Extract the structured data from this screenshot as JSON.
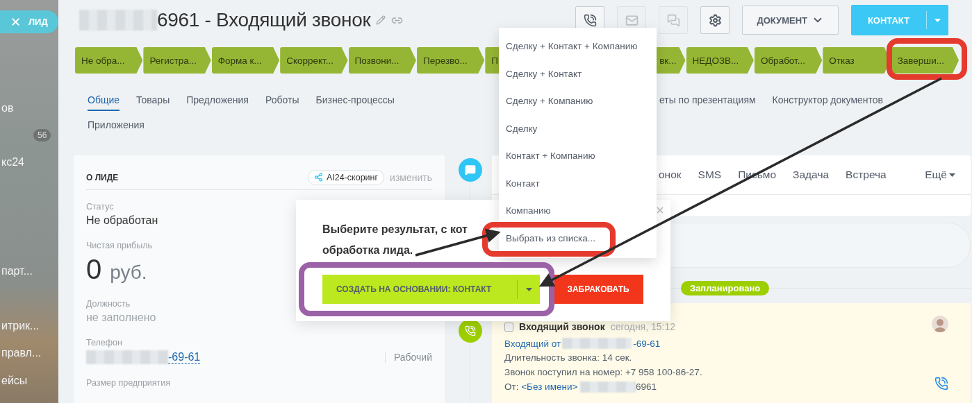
{
  "close_tab": {
    "label": "ЛИД"
  },
  "sidebar": {
    "items": [
      {
        "label": "ов"
      },
      {
        "badge": "56"
      },
      {
        "label": "кс24"
      },
      {
        "label": "парт..."
      },
      {
        "label": "итрик..."
      },
      {
        "label": "правл..."
      },
      {
        "label": "ейсы"
      }
    ]
  },
  "header": {
    "title": "6961 - Входящий звонок",
    "buttons": [
      {
        "kind": "phone",
        "disabled": false
      },
      {
        "kind": "mail",
        "disabled": true
      },
      {
        "kind": "chat",
        "disabled": true
      },
      {
        "kind": "settings",
        "disabled": false
      }
    ],
    "document_button": "ДОКУМЕНТ",
    "contact_button": "КОНТАКТ"
  },
  "stages": [
    {
      "label": "Не обра..."
    },
    {
      "label": "Регистра..."
    },
    {
      "label": "Форма к..."
    },
    {
      "label": "Скоррект..."
    },
    {
      "label": "Позвони..."
    },
    {
      "label": "Перезво..."
    },
    {
      "label": "П"
    },
    {
      "label": "вк...",
      "partly_hidden": true
    },
    {
      "label": "НЕДОЗВ..."
    },
    {
      "label": "Обработ..."
    },
    {
      "label": "Отказ"
    },
    {
      "label": "Заверши..."
    }
  ],
  "tabs": [
    {
      "label": "Общие",
      "selected": true
    },
    {
      "label": "Товары",
      "selected": false
    },
    {
      "label": "Предложения",
      "selected": false
    },
    {
      "label": "Роботы",
      "selected": false
    },
    {
      "label": "Бизнес-процессы",
      "selected": false
    },
    {
      "label": "еты по презентациям",
      "selected": false,
      "partly_hidden": true
    },
    {
      "label": "Конструктор документов",
      "selected": false
    },
    {
      "label": "Приложения",
      "selected": false
    }
  ],
  "about": {
    "title": "О ЛИДЕ",
    "scoring_badge": "AI24-скоринг",
    "edit_link": "изменить",
    "fields": [
      {
        "kind": "text",
        "label": "Статус",
        "value": "Не обработан"
      },
      {
        "kind": "money",
        "label": "Чистая прибыль",
        "value": "0",
        "unit": "руб."
      },
      {
        "kind": "empty",
        "label": "Должность",
        "value": "не заполнено"
      },
      {
        "kind": "phone",
        "label": "Телефон",
        "value": "-69-61",
        "type": "Рабочий"
      },
      {
        "kind": "label",
        "label": "Размер предприятия"
      }
    ]
  },
  "activity_tabs": [
    {
      "label": "онок",
      "partly_hidden": true
    },
    {
      "label": "SMS"
    },
    {
      "label": "Письмо"
    },
    {
      "label": "Задача"
    },
    {
      "label": "Встреча"
    },
    {
      "label": "Ещё",
      "kind": "more"
    }
  ],
  "scheduled_label": "Запланировано",
  "activity": {
    "checked": false,
    "title": "Входящий звонок",
    "time": "сегодня, 15:12",
    "link": "Входящий от",
    "link_suffix": "-69-61",
    "lines": [
      "Длительность звонка: 14 сек.",
      "Звонок поступил на номер: +7 958 100-86-27."
    ],
    "from_label": "От:",
    "from_name": "<Без имени>",
    "from_number": "6961"
  },
  "popup": {
    "message_lines": [
      "Выберите результат, с кот",
      "обработка лида."
    ],
    "create_button": "СОЗДАТЬ НА ОСНОВАНИИ: КОНТАКТ",
    "reject_button": "ЗАБРАКОВАТЬ"
  },
  "dropdown": {
    "items": [
      "Сделку + Контакт + Компанию",
      "Сделку + Контакт",
      "Сделку + Компанию",
      "Сделку",
      "Контакт + Компанию",
      "Контакт",
      "Компанию",
      "Выбрать из списка..."
    ]
  },
  "annotations": [
    {
      "kind": "frame",
      "color": "#e53a2e"
    },
    {
      "kind": "frame",
      "color": "#e53a2e"
    },
    {
      "kind": "frame",
      "color": "#9b62a7"
    },
    {
      "kind": "arrow",
      "color": "#2b2b2b"
    },
    {
      "kind": "arrow",
      "color": "#2b2b2b"
    }
  ]
}
